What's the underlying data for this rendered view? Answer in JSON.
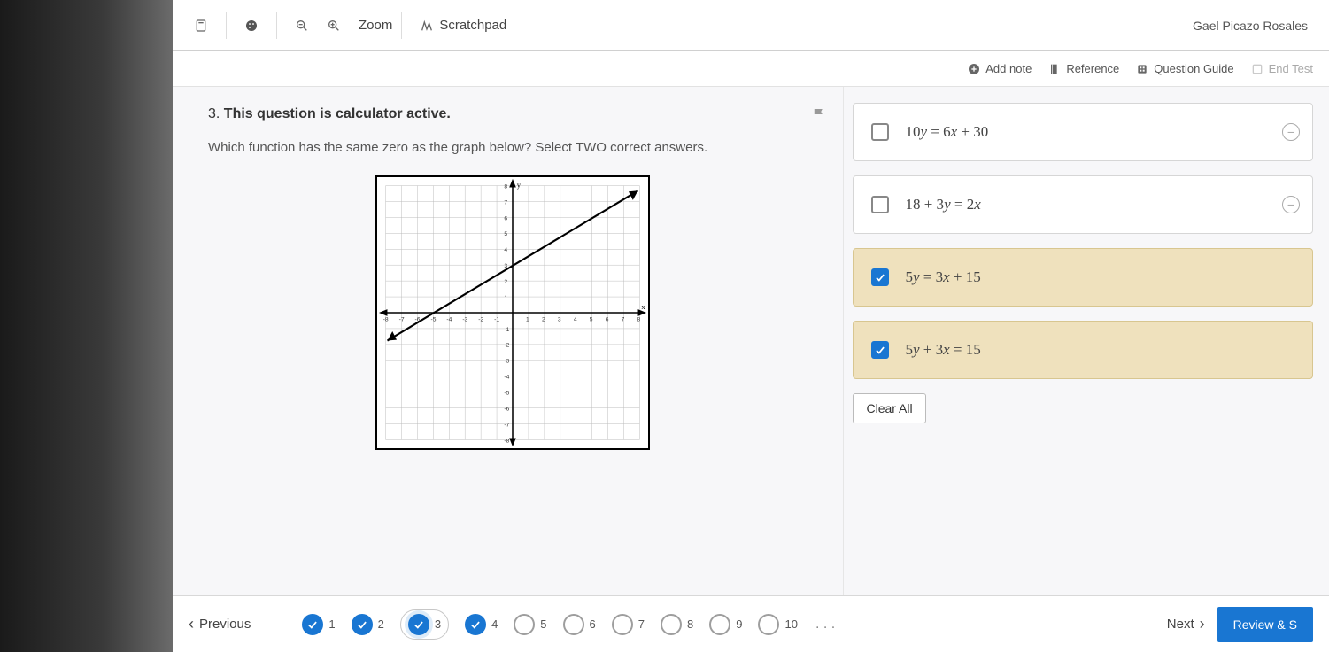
{
  "user_name": "Gael Picazo Rosales",
  "toolbar": {
    "zoom_label": "Zoom",
    "scratchpad_label": "Scratchpad"
  },
  "actions": {
    "add_note": "Add note",
    "reference": "Reference",
    "question_guide": "Question Guide",
    "end_test": "End Test"
  },
  "question": {
    "number": "3.",
    "status": "This question is calculator active.",
    "prompt": "Which function has the same zero as the graph below? Select TWO correct answers."
  },
  "options": [
    {
      "latex": "10y = 6x + 30",
      "selected": false
    },
    {
      "latex": "18 + 3y = 2x",
      "selected": false
    },
    {
      "latex": "5y = 3x + 15",
      "selected": true
    },
    {
      "latex": "5y + 3x = 15",
      "selected": true
    }
  ],
  "clear_all": "Clear All",
  "nav": {
    "previous": "Previous",
    "next": "Next",
    "review": "Review & S",
    "items": [
      {
        "n": "1",
        "done": true,
        "current": false
      },
      {
        "n": "2",
        "done": true,
        "current": false
      },
      {
        "n": "3",
        "done": true,
        "current": true
      },
      {
        "n": "4",
        "done": true,
        "current": false
      },
      {
        "n": "5",
        "done": false,
        "current": false
      },
      {
        "n": "6",
        "done": false,
        "current": false
      },
      {
        "n": "7",
        "done": false,
        "current": false
      },
      {
        "n": "8",
        "done": false,
        "current": false
      },
      {
        "n": "9",
        "done": false,
        "current": false
      },
      {
        "n": "10",
        "done": false,
        "current": false
      }
    ]
  },
  "chart_data": {
    "type": "line",
    "title": "",
    "xlabel": "x",
    "ylabel": "y",
    "xlim": [
      -8,
      8
    ],
    "ylim": [
      -8,
      8
    ],
    "x_ticks": [
      -8,
      -7,
      -6,
      -5,
      -4,
      -3,
      -2,
      -1,
      1,
      2,
      3,
      4,
      5,
      6,
      7,
      8
    ],
    "y_ticks": [
      -8,
      -7,
      -6,
      -5,
      -4,
      -3,
      -2,
      -1,
      1,
      2,
      3,
      4,
      5,
      6,
      7,
      8
    ],
    "series": [
      {
        "name": "line",
        "points": [
          [
            -8,
            -1.8
          ],
          [
            -5,
            0
          ],
          [
            8,
            7.8
          ]
        ],
        "note": "approximate straight line with zero at x = -5, slope ≈ 0.6"
      }
    ]
  }
}
